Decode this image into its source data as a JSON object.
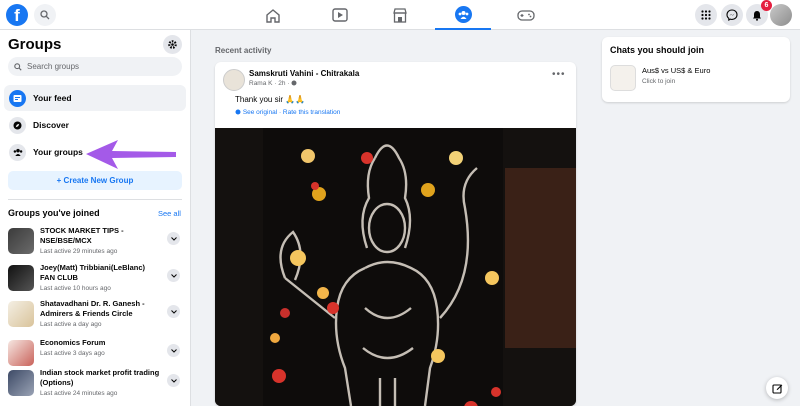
{
  "topbar": {
    "logo": "f",
    "notifications_badge": "6",
    "nav": [
      "home-icon",
      "watch-icon",
      "marketplace-icon",
      "groups-icon",
      "gaming-icon"
    ],
    "active_nav": "groups-icon"
  },
  "sidebar": {
    "title": "Groups",
    "search_placeholder": "Search groups",
    "items": [
      {
        "label": "Your feed",
        "icon": "feed-icon"
      },
      {
        "label": "Discover",
        "icon": "compass-icon"
      },
      {
        "label": "Your groups",
        "icon": "groups-icon"
      }
    ],
    "create_label": "+ Create New Group",
    "joined_title": "Groups you've joined",
    "see_all": "See all",
    "groups": [
      {
        "name": "STOCK MARKET TIPS - NSE/BSE/MCX",
        "time": "Last active 29 minutes ago"
      },
      {
        "name": "Joey(Matt) Tribbiani(LeBlanc) FAN CLUB",
        "time": "Last active 10 hours ago"
      },
      {
        "name": "Shatavadhani Dr. R. Ganesh - Admirers & Friends Circle",
        "time": "Last active a day ago"
      },
      {
        "name": "Economics Forum",
        "time": "Last active 3 days ago"
      },
      {
        "name": "Indian stock market profit trading (Options)",
        "time": "Last active 24 minutes ago"
      }
    ]
  },
  "feed": {
    "recent_label": "Recent activity",
    "post": {
      "group": "Samskruti Vahini - Chitrakala",
      "author_time": "Rama K · 2h ·",
      "text": "Thank you sir 🙏🙏",
      "translation": "See original · Rate this translation"
    }
  },
  "chats": {
    "title": "Chats you should join",
    "item_name": "Aus$ vs US$ & Euro",
    "item_sub": "Click to join"
  },
  "colors": {
    "accent": "#1877f2",
    "annotation_arrow": "#a45ae8"
  }
}
